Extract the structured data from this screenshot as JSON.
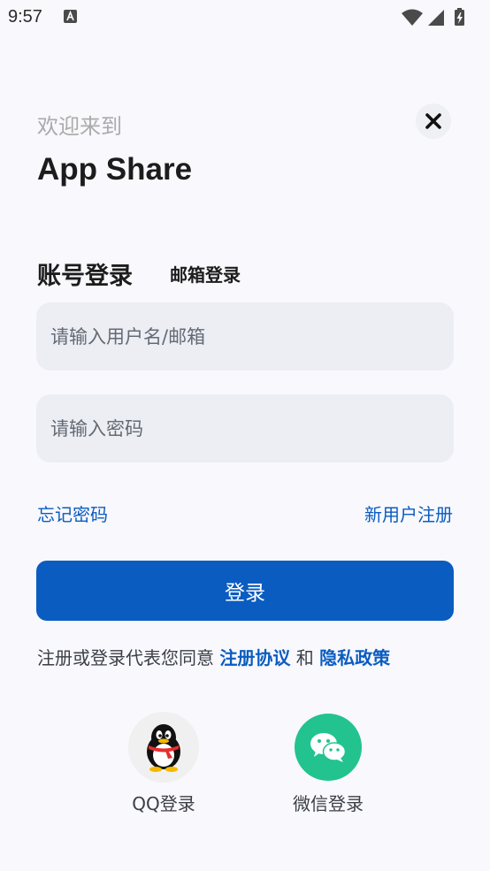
{
  "status_bar": {
    "time": "9:57"
  },
  "header": {
    "welcome": "欢迎来到",
    "app_name": "App Share"
  },
  "tabs": {
    "account_login": "账号登录",
    "email_login": "邮箱登录"
  },
  "form": {
    "username_placeholder": "请输入用户名/邮箱",
    "password_placeholder": "请输入密码",
    "forgot_password": "忘记密码",
    "new_user_register": "新用户注册",
    "login_button": "登录"
  },
  "agreement": {
    "prefix": "注册或登录代表您同意",
    "terms": "注册协议",
    "and": "和",
    "privacy": "隐私政策"
  },
  "social": {
    "qq_label": "QQ登录",
    "wechat_label": "微信登录"
  },
  "colors": {
    "primary": "#0a5cc0",
    "background": "#f8f8fd",
    "input_bg": "#eceef4",
    "wechat": "#22c38e"
  },
  "icons": [
    "a-notification-icon",
    "wifi-icon",
    "signal-icon",
    "battery-icon",
    "close-icon",
    "qq-penguin-icon",
    "wechat-icon"
  ]
}
